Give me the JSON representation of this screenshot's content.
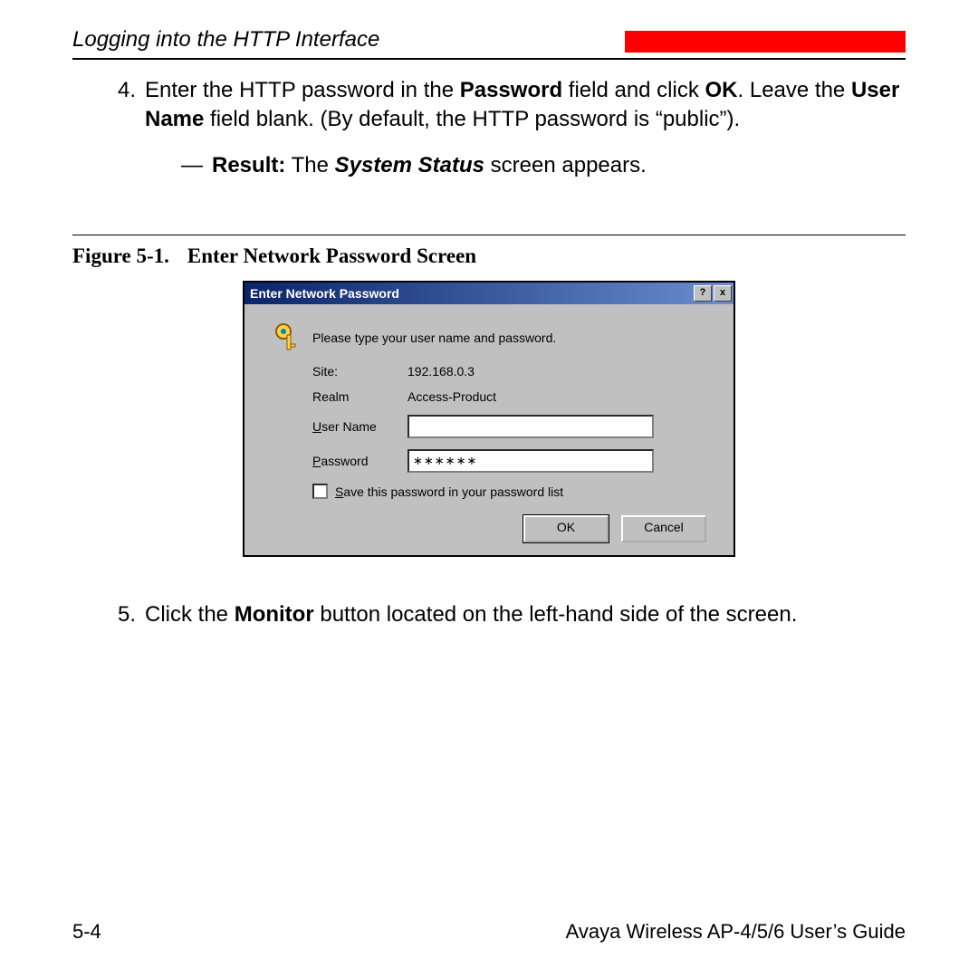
{
  "header": {
    "title": "Logging into the HTTP Interface"
  },
  "step4": {
    "num": "4.",
    "t1": "Enter the HTTP password in the ",
    "b1": "Password",
    "t2": " field and click ",
    "b2": "OK",
    "t3": ". Leave the ",
    "b3": "User Name",
    "t4": " field blank. (By default, the HTTP password is “public”)."
  },
  "result": {
    "dash": "—",
    "lbl": "Result:",
    "t1": " The ",
    "bi": "System Status",
    "t2": " screen appears."
  },
  "figure": {
    "num": "Figure 5-1.",
    "title": "Enter Network Password Screen"
  },
  "dialog": {
    "title": "Enter Network Password",
    "help": "?",
    "close": "x",
    "instruction": "Please type your user name and password.",
    "site_lbl": "Site:",
    "site_val": "192.168.0.3",
    "realm_lbl": "Realm",
    "realm_val": "Access-Product",
    "user_u": "U",
    "user_rest": "ser Name",
    "pass_u": "P",
    "pass_rest": "assword",
    "pass_val": "∗∗∗∗∗∗",
    "save_u": "S",
    "save_rest": "ave this password in your password list",
    "ok": "OK",
    "cancel": "Cancel"
  },
  "step5": {
    "num": "5.",
    "t1": "Click the ",
    "b1": "Monitor",
    "t2": " button located on the left-hand side of the screen."
  },
  "footer": {
    "page": "5-4",
    "book": "Avaya Wireless AP-4/5/6 User’s Guide"
  }
}
